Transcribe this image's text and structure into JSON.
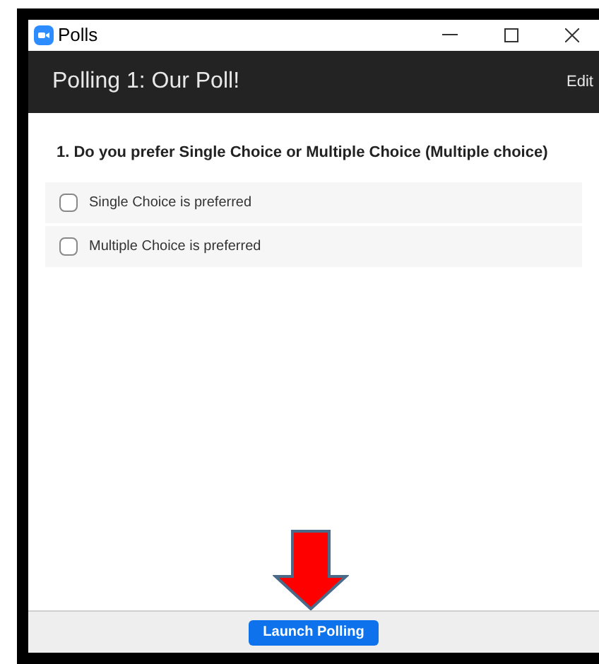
{
  "window": {
    "title": "Polls"
  },
  "header": {
    "title": "Polling 1: Our Poll!",
    "edit": "Edit"
  },
  "question": "1. Do you prefer Single Choice or Multiple Choice (Multiple choice)",
  "options": [
    {
      "label": "Single Choice is preferred",
      "checked": false
    },
    {
      "label": "Multiple Choice is preferred",
      "checked": false
    }
  ],
  "footer": {
    "button": "Launch Polling"
  }
}
